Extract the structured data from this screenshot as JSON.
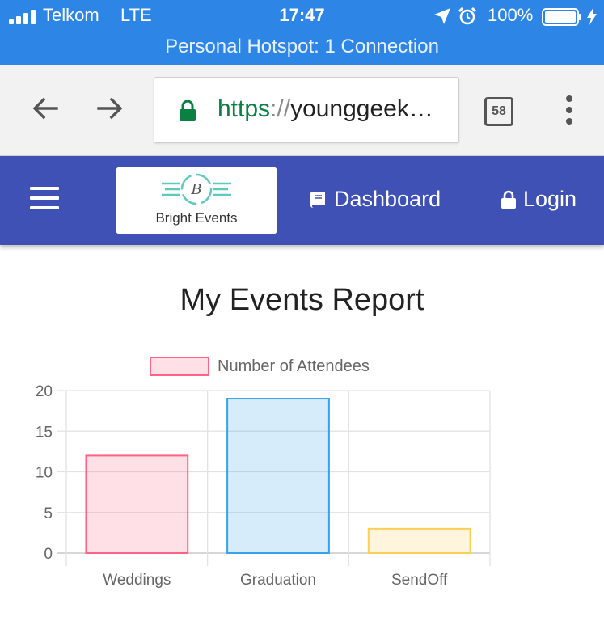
{
  "status_bar": {
    "carrier": "Telkom",
    "network": "LTE",
    "time": "17:47",
    "battery": "100%",
    "hotspot": "Personal Hotspot: 1 Connection",
    "icons": [
      "signal-icon",
      "location-icon",
      "alarm-icon",
      "battery-icon",
      "charging-icon"
    ]
  },
  "browser": {
    "url_scheme": "https",
    "url_sep": "://",
    "url_rest": "younggeek…",
    "tab_count": "58",
    "icons": [
      "back-arrow-icon",
      "forward-arrow-icon",
      "lock-icon",
      "more-vert-icon"
    ]
  },
  "navbar": {
    "brand_mark": "B",
    "brand_name": "Bright Events",
    "links": [
      {
        "label": "Dashboard",
        "icon": "book-icon"
      },
      {
        "label": "Login",
        "icon": "lock-icon"
      }
    ],
    "color": "#3f51b5"
  },
  "page": {
    "title": "My Events Report"
  },
  "chart_data": {
    "type": "bar",
    "categories": [
      "Weddings",
      "Graduation",
      "SendOff"
    ],
    "series": [
      {
        "name": "Number of Attendees",
        "values": [
          12,
          19,
          3
        ]
      }
    ],
    "bar_fills": [
      "rgba(255,99,132,0.2)",
      "rgba(54,162,235,0.2)",
      "rgba(255,206,86,0.2)"
    ],
    "bar_borders": [
      "#ff6384",
      "#36a2eb",
      "#ffce56"
    ],
    "ylim": [
      0,
      20
    ],
    "yticks": [
      0,
      5,
      10,
      15,
      20
    ],
    "legend": "top-center",
    "grid": true
  }
}
